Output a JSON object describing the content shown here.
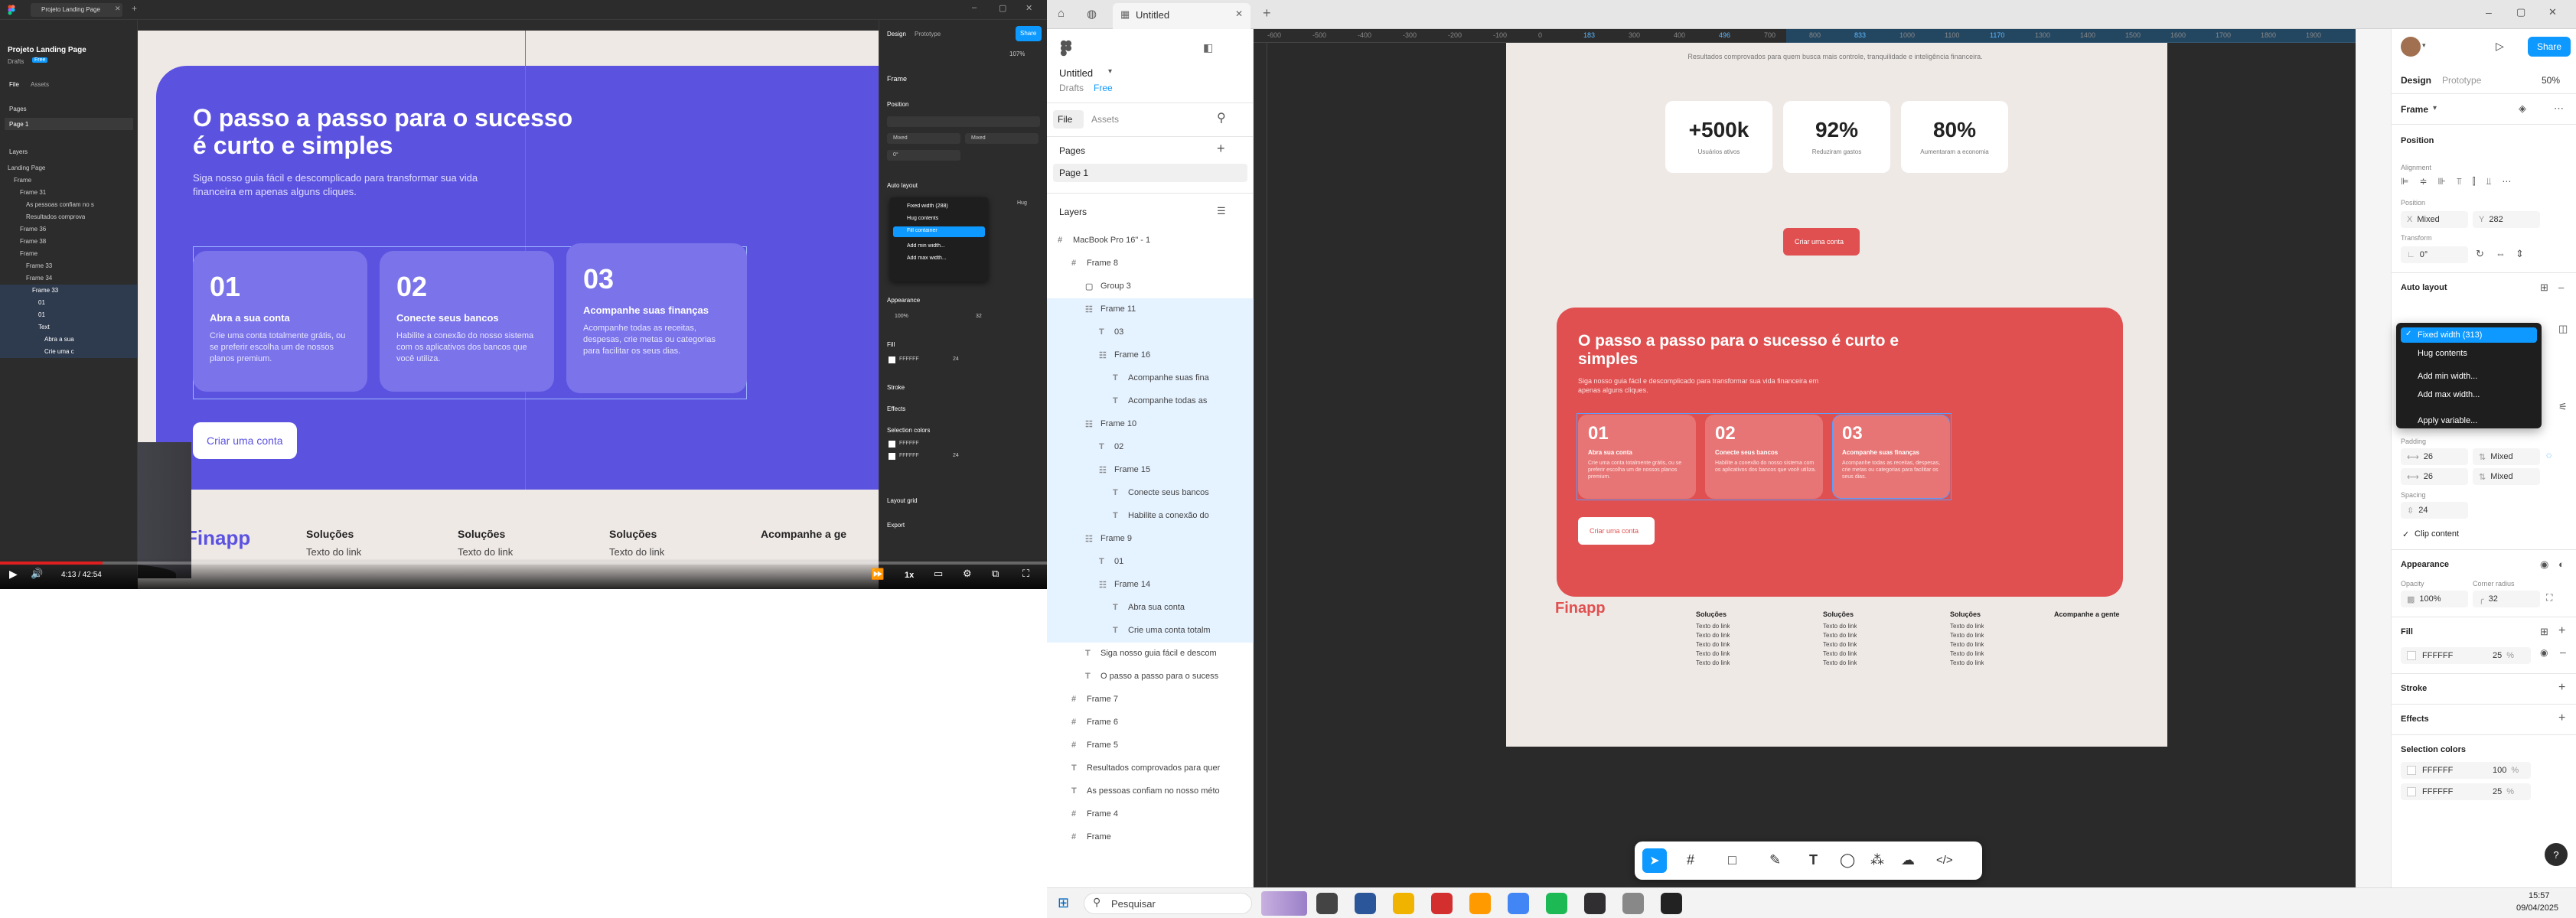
{
  "video": {
    "title_tab": "Projeto Landing Page",
    "left_panel": {
      "file_name": "Projeto Landing Page",
      "drafts": "Drafts",
      "badge": "Free",
      "tabs": [
        "File",
        "Assets"
      ],
      "pages_label": "Pages",
      "page": "Page 1",
      "layers_label": "Layers",
      "layers": [
        "Landing Page",
        "Frame",
        "Frame 31",
        "As pessoas confiam no s",
        "Resultados comprova",
        "Frame 36",
        "Frame 38",
        "Frame",
        "Frame 33",
        "Frame 34",
        "Frame 33",
        "01",
        "01",
        "Text",
        "Abra a sua",
        "Crie uma c"
      ]
    },
    "design": {
      "heading": "O passo a passo para o sucesso é curto e simples",
      "sub": "Siga nosso guia fácil e descomplicado para transformar sua vida financeira em apenas alguns cliques.",
      "cards": [
        {
          "num": "01",
          "title": "Abra a sua conta",
          "text": "Crie uma conta totalmente grátis, ou se preferir escolha um de nossos planos premium."
        },
        {
          "num": "02",
          "title": "Conecte seus bancos",
          "text": "Habilite a conexão do nosso sistema com os aplicativos dos bancos que você utiliza."
        },
        {
          "num": "03",
          "title": "Acompanhe suas finanças",
          "text": "Acompanhe todas as receitas, despesas, crie metas ou categorias para facilitar os seus dias."
        }
      ],
      "cta": "Criar uma conta",
      "footer_logo": "Finapp",
      "footer_cols": [
        {
          "title": "Soluções",
          "link": "Texto do link"
        },
        {
          "title": "Soluções",
          "link": "Texto do link"
        },
        {
          "title": "Soluções",
          "link": "Texto do link"
        },
        {
          "title": "Acompanhe a ge",
          "link": ""
        }
      ]
    },
    "right_panel": {
      "tabs": [
        "Design",
        "Prototype"
      ],
      "share": "Share",
      "zoom": "107%",
      "frame_label": "Frame",
      "position": "Position",
      "auto_layout": "Auto layout",
      "dropdown": [
        "Fixed width (288)",
        "Hug contents",
        "Fill container",
        "Add min width...",
        "Add max width..."
      ],
      "appearance": "Appearance",
      "opacity": "100%",
      "radius": "32",
      "fill": "Fill",
      "fill_hex": "FFFFFF",
      "fill_pct": "24",
      "stroke": "Stroke",
      "effects": "Effects",
      "selection_colors": "Selection colors",
      "sel1": "FFFFFF",
      "sel2": "FFFFFF",
      "sel2_pct": "24",
      "layout_grid": "Layout grid",
      "export": "Export",
      "mixed": "Mixed",
      "hug": "Hug",
      "zero": "0°"
    },
    "controls": {
      "time": "4:13 / 42:54",
      "speed": "1x"
    }
  },
  "figma": {
    "tab_title": "Untitled",
    "file_name": "Untitled",
    "drafts": "Drafts",
    "free": "Free",
    "left_tabs": [
      "File",
      "Assets"
    ],
    "pages_label": "Pages",
    "page": "Page 1",
    "layers_label": "Layers",
    "layers": [
      {
        "name": "MacBook Pro 16\" - 1",
        "indent": 0,
        "icon": "frame-icon",
        "sel": false
      },
      {
        "name": "Frame 8",
        "indent": 1,
        "icon": "frame-icon",
        "sel": false
      },
      {
        "name": "Group 3",
        "indent": 2,
        "icon": "group-icon",
        "sel": false
      },
      {
        "name": "Frame 11",
        "indent": 2,
        "icon": "autolayout-icon",
        "sel": true
      },
      {
        "name": "03",
        "indent": 3,
        "icon": "text-icon",
        "sel": true
      },
      {
        "name": "Frame 16",
        "indent": 3,
        "icon": "autolayout-icon",
        "sel": true
      },
      {
        "name": "Acompanhe suas fina",
        "indent": 4,
        "icon": "text-icon",
        "sel": true
      },
      {
        "name": "Acompanhe todas as",
        "indent": 4,
        "icon": "text-icon",
        "sel": true
      },
      {
        "name": "Frame 10",
        "indent": 2,
        "icon": "autolayout-icon",
        "sel": true
      },
      {
        "name": "02",
        "indent": 3,
        "icon": "text-icon",
        "sel": true
      },
      {
        "name": "Frame 15",
        "indent": 3,
        "icon": "autolayout-icon",
        "sel": true
      },
      {
        "name": "Conecte seus bancos",
        "indent": 4,
        "icon": "text-icon",
        "sel": true
      },
      {
        "name": "Habilite a conexão do",
        "indent": 4,
        "icon": "text-icon",
        "sel": true
      },
      {
        "name": "Frame 9",
        "indent": 2,
        "icon": "autolayout-icon",
        "sel": true
      },
      {
        "name": "01",
        "indent": 3,
        "icon": "text-icon",
        "sel": true
      },
      {
        "name": "Frame 14",
        "indent": 3,
        "icon": "autolayout-icon",
        "sel": true
      },
      {
        "name": "Abra sua conta",
        "indent": 4,
        "icon": "text-icon",
        "sel": true
      },
      {
        "name": "Crie uma conta totalm",
        "indent": 4,
        "icon": "text-icon",
        "sel": true
      },
      {
        "name": "Siga nosso guia fácil e descom",
        "indent": 2,
        "icon": "text-icon",
        "sel": false
      },
      {
        "name": "O passo a passo para o sucess",
        "indent": 2,
        "icon": "text-icon",
        "sel": false
      },
      {
        "name": "Frame 7",
        "indent": 1,
        "icon": "frame-icon",
        "sel": false
      },
      {
        "name": "Frame 6",
        "indent": 1,
        "icon": "frame-icon",
        "sel": false
      },
      {
        "name": "Frame 5",
        "indent": 1,
        "icon": "frame-icon",
        "sel": false
      },
      {
        "name": "Resultados comprovados para quer",
        "indent": 1,
        "icon": "text-icon",
        "sel": false
      },
      {
        "name": "As pessoas confiam no nosso méto",
        "indent": 1,
        "icon": "text-icon",
        "sel": false
      },
      {
        "name": "Frame 4",
        "indent": 1,
        "icon": "frame-icon",
        "sel": false
      },
      {
        "name": "Frame",
        "indent": 1,
        "icon": "frame-icon",
        "sel": false
      }
    ],
    "ruler": [
      "-600",
      "-500",
      "-400",
      "-300",
      "-200",
      "-100",
      "0",
      "183",
      "300",
      "400",
      "496",
      "700",
      "800",
      "833",
      "1000",
      "1100",
      "1170",
      "1300",
      "1400",
      "1500",
      "1600",
      "1700",
      "1800",
      "1900"
    ],
    "design": {
      "top_text": "Resultados comprovados para quem busca mais controle, tranquilidade e inteligência financeira.",
      "stats": [
        {
          "value": "+500k",
          "label": "Usuários ativos"
        },
        {
          "value": "92%",
          "label": "Reduziram gastos"
        },
        {
          "value": "80%",
          "label": "Aumentaram a economia"
        }
      ],
      "cta_top": "Criar uma conta",
      "heading": "O passo a passo para o sucesso é curto e simples",
      "sub": "Siga nosso guia fácil e descomplicado para transformar sua vida financeira em apenas alguns cliques.",
      "cards": [
        {
          "num": "01",
          "title": "Abra sua conta",
          "text": "Crie uma conta totalmente grátis, ou se preferir escolha um de nossos planos premium."
        },
        {
          "num": "02",
          "title": "Conecte seus bancos",
          "text": "Habilite a conexão do nosso sistema com os aplicativos dos bancos que você utiliza."
        },
        {
          "num": "03",
          "title": "Acompanhe suas finanças",
          "text": "Acompanhe todas as receitas, despesas, crie metas ou categorias para facilitar os seus dias."
        }
      ],
      "cta": "Criar uma conta",
      "footer_logo": "Finapp",
      "footer_cols": [
        {
          "title": "Soluções",
          "links": [
            "Texto do link",
            "Texto do link",
            "Texto do link",
            "Texto do link",
            "Texto do link"
          ]
        },
        {
          "title": "Soluções",
          "links": [
            "Texto do link",
            "Texto do link",
            "Texto do link",
            "Texto do link",
            "Texto do link"
          ]
        },
        {
          "title": "Soluções",
          "links": [
            "Texto do link",
            "Texto do link",
            "Texto do link",
            "Texto do link",
            "Texto do link"
          ]
        }
      ],
      "footer_right": "Acompanhe a gente"
    },
    "right": {
      "tabs": [
        "Design",
        "Prototype"
      ],
      "zoom": "50%",
      "share": "Share",
      "frame_label": "Frame",
      "position": "Position",
      "alignment": "Alignment",
      "position_sub": "Position",
      "x": "Mixed",
      "y": "282",
      "transform": "Transform",
      "rot": "0°",
      "auto_layout": "Auto layout",
      "dropdown": [
        "Fixed width (313)",
        "Hug contents",
        "Add min width...",
        "Add max width...",
        "Apply variable..."
      ],
      "padding": "Padding",
      "pad1": "26",
      "pad2": "Mixed",
      "pad3": "26",
      "pad4": "Mixed",
      "spacing": "Spacing",
      "spacing_val": "24",
      "clip": "Clip content",
      "appearance": "Appearance",
      "opacity_label": "Opacity",
      "radius_label": "Corner radius",
      "opacity": "100%",
      "radius": "32",
      "fill": "Fill",
      "fill_hex": "FFFFFF",
      "fill_pct": "25",
      "stroke": "Stroke",
      "effects": "Effects",
      "selection_colors": "Selection colors",
      "sel1_hex": "FFFFFF",
      "sel1_pct": "100",
      "sel2_hex": "FFFFFF",
      "sel2_pct": "25",
      "pct": "%"
    },
    "help": "?"
  },
  "taskbar": {
    "search": "Pesquisar",
    "time": "15:57",
    "date": "09/04/2025"
  },
  "colors": {
    "video_bg": "#5b52e0",
    "video_card": "#7a73ea",
    "design_red": "#e05050",
    "design_card": "#e87575",
    "page_bg": "#efe9e6",
    "figma_blue": "#0d99ff",
    "select_blue": "#d9ecff"
  }
}
